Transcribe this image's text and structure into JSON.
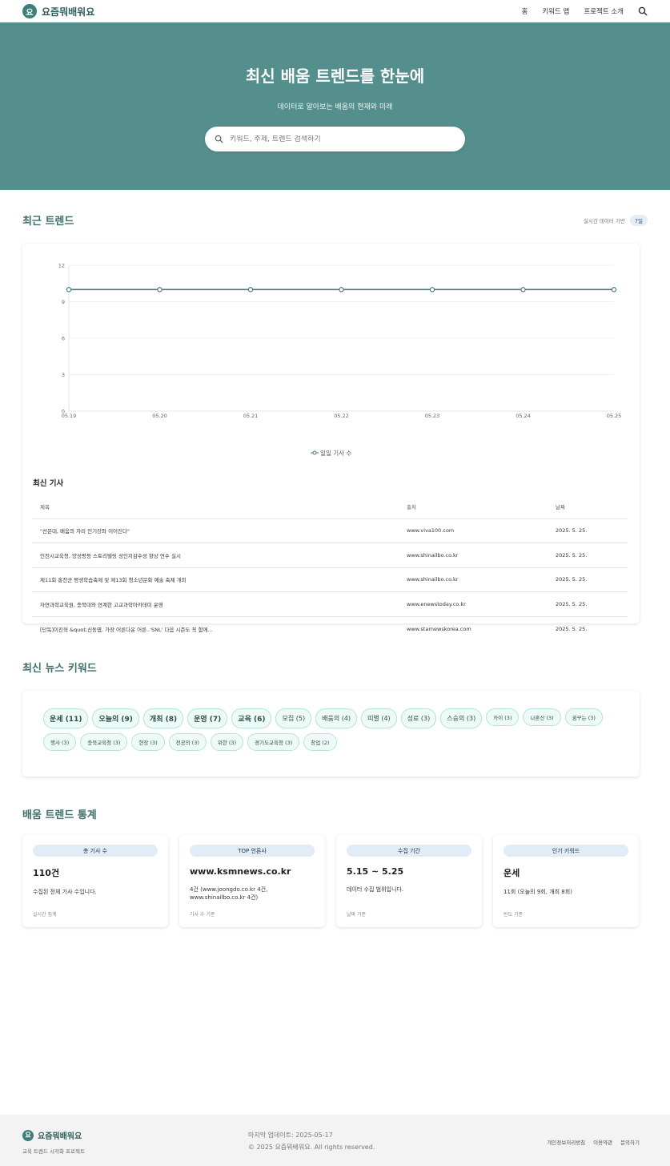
{
  "nav": {
    "logo_char": "요",
    "brand": "요즘뭐배워요",
    "links": [
      "홈",
      "키워드 맵",
      "프로젝트 소개"
    ]
  },
  "hero": {
    "title": "최신 배움 트렌드를 한눈에",
    "subtitle": "데이터로 알아보는 배움의 현재와 미래",
    "search_placeholder": "키워드, 주제, 트렌드 검색하기"
  },
  "recent": {
    "title": "최근 트렌드",
    "meta_text": "실시간 데이터 기반",
    "period_badge": "7일"
  },
  "chart_data": {
    "type": "line",
    "categories": [
      "05.19",
      "05.20",
      "05.21",
      "05.22",
      "05.23",
      "05.24",
      "05.25"
    ],
    "series": [
      {
        "name": "일일 기사 수",
        "values": [
          10,
          10,
          10,
          10,
          10,
          10,
          10
        ]
      }
    ],
    "ylim": [
      0,
      12
    ],
    "yticks": [
      0,
      3,
      6,
      9,
      12
    ],
    "grid": true,
    "legend": "bottom",
    "color": "#3f7f7b"
  },
  "articles": {
    "title": "최신 기사",
    "headers": [
      "제목",
      "출처",
      "날짜"
    ],
    "rows": [
      [
        "\"선문대, 배움의 자리 인기강좌 이어진다\"",
        "www.viva100.com",
        "2025. 5. 25."
      ],
      [
        "인천시교육청, 양성평등 스토리텔링 성인지감수성 향상 연수 실시",
        "www.shinailbo.co.kr",
        "2025. 5. 25."
      ],
      [
        "제11회 홍천군 평생학습축제 및 제13회 청소년문화 예술 축제 개최",
        "www.shinailbo.co.kr",
        "2025. 5. 25."
      ],
      [
        "자연과학교육원, 충북대와 연계한 고교과학아카데미 운영",
        "www.enewstoday.co.kr",
        "2025. 5. 25."
      ],
      [
        "[단독]이진혁 &quot;신동엽, 가장 어른다운 어른..'SNL' 다음 시즌도 꼭 함께...",
        "www.starnewskorea.com",
        "2025. 5. 25."
      ]
    ]
  },
  "keywords": {
    "title": "최신 뉴스 키워드",
    "items": [
      {
        "label": "운세 (11)",
        "size": "l"
      },
      {
        "label": "오늘의 (9)",
        "size": "l"
      },
      {
        "label": "개최 (8)",
        "size": "l"
      },
      {
        "label": "운영 (7)",
        "size": "l"
      },
      {
        "label": "교육 (6)",
        "size": "l"
      },
      {
        "label": "모집 (5)",
        "size": "m"
      },
      {
        "label": "배움의 (4)",
        "size": "m"
      },
      {
        "label": "띠별 (4)",
        "size": "m"
      },
      {
        "label": "성료 (3)",
        "size": "m"
      },
      {
        "label": "스승의 (3)",
        "size": "m"
      },
      {
        "label": "카이 (3)",
        "size": "s"
      },
      {
        "label": "나혼산 (3)",
        "size": "s"
      },
      {
        "label": "꿈꾸는 (3)",
        "size": "s"
      },
      {
        "label": "행사 (3)",
        "size": "s"
      },
      {
        "label": "충북교육청 (3)",
        "size": "s"
      },
      {
        "label": "현장 (3)",
        "size": "s"
      },
      {
        "label": "전공의 (3)",
        "size": "s"
      },
      {
        "label": "위한 (3)",
        "size": "s"
      },
      {
        "label": "경기도교육청 (3)",
        "size": "s"
      },
      {
        "label": "창업 (2)",
        "size": "s"
      }
    ]
  },
  "stats": {
    "title": "배움 트렌드 통계",
    "cards": [
      {
        "label": "총 기사 수",
        "value": "110건",
        "desc": "수집된 전체 기사 수입니다.",
        "foot": "실시간 집계"
      },
      {
        "label": "TOP 언론사",
        "value": "www.ksmnews.co.kr",
        "desc": "4건 (www.joongdo.co.kr 4건, www.shinailbo.co.kr 4건)",
        "foot": "기사 수 기준"
      },
      {
        "label": "수집 기간",
        "value": "5.15 ~ 5.25",
        "desc": "데이터 수집 범위입니다.",
        "foot": "날짜 기준"
      },
      {
        "label": "인기 키워드",
        "value": "운세",
        "desc": "11회 (오늘의 9회, 개최 8회)",
        "foot": "빈도 기준"
      }
    ]
  },
  "footer": {
    "brand": "요즘뭐배워요",
    "tagline": "교육 트렌드 시각화 프로젝트",
    "updated": "마지막 업데이트: 2025-05-17",
    "copyright": "© 2025 요즘뭐배워요. All rights reserved.",
    "links": [
      "개인정보처리방침",
      "이용약관",
      "문의하기"
    ]
  }
}
